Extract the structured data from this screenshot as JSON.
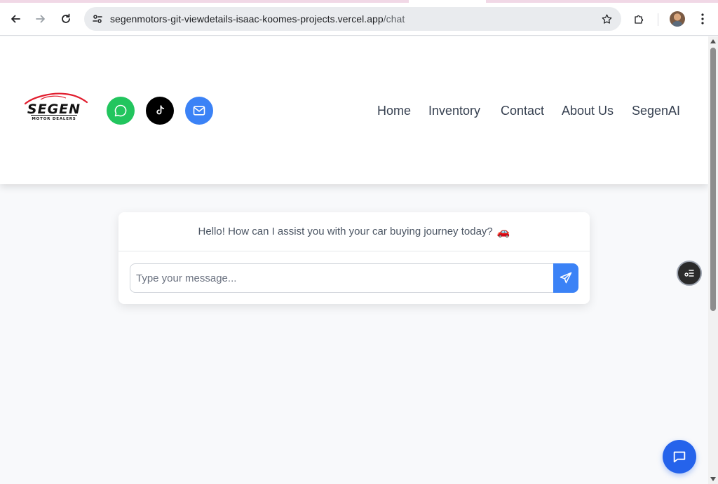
{
  "browser": {
    "url_host": "segenmotors-git-viewdetails-isaac-koomes-projects.vercel.app",
    "url_path": "/chat",
    "icons": [
      "back-arrow-icon",
      "forward-arrow-icon",
      "reload-icon",
      "site-settings-icon",
      "bookmark-star-icon",
      "extensions-puzzle-icon",
      "profile-avatar-icon",
      "kebab-menu-icon"
    ]
  },
  "header": {
    "logo": {
      "brand": "SEGEN",
      "tagline": "MOTOR DEALERS"
    },
    "social": [
      {
        "name": "whatsapp",
        "icon": "whatsapp-icon",
        "color": "#22c55e"
      },
      {
        "name": "tiktok",
        "icon": "tiktok-icon",
        "color": "#000000"
      },
      {
        "name": "email",
        "icon": "mail-icon",
        "color": "#3b82f6"
      }
    ],
    "nav": [
      "Home",
      "Inventory",
      "Contact",
      "About Us",
      "SegenAI"
    ]
  },
  "chat": {
    "greeting": "Hello! How can I assist you with your car buying journey today?",
    "greeting_emoji": "🚗",
    "input_placeholder": "Type your message...",
    "input_value": "",
    "send_icon": "send-paper-plane-icon"
  },
  "floating": {
    "menu_icon": "list-menu-icon",
    "chat_icon": "chat-bubble-icon"
  },
  "colors": {
    "accent": "#3b82f6",
    "fab": "#2563eb",
    "page_bg": "#f8f9fb",
    "nav_text": "#374151",
    "logo_red": "#e11d2e"
  }
}
